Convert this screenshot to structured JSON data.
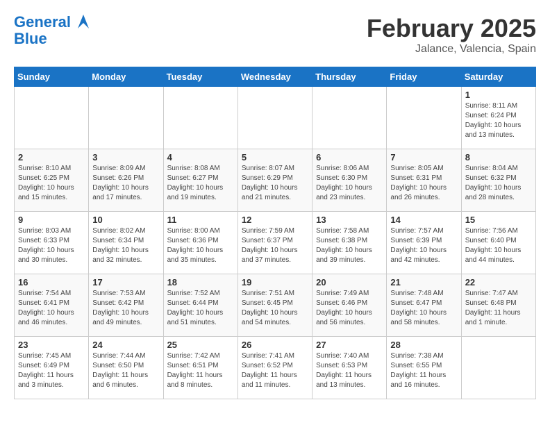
{
  "header": {
    "logo_line1": "General",
    "logo_line2": "Blue",
    "title": "February 2025",
    "subtitle": "Jalance, Valencia, Spain"
  },
  "weekdays": [
    "Sunday",
    "Monday",
    "Tuesday",
    "Wednesday",
    "Thursday",
    "Friday",
    "Saturday"
  ],
  "weeks": [
    [
      {
        "day": "",
        "info": ""
      },
      {
        "day": "",
        "info": ""
      },
      {
        "day": "",
        "info": ""
      },
      {
        "day": "",
        "info": ""
      },
      {
        "day": "",
        "info": ""
      },
      {
        "day": "",
        "info": ""
      },
      {
        "day": "1",
        "info": "Sunrise: 8:11 AM\nSunset: 6:24 PM\nDaylight: 10 hours and 13 minutes."
      }
    ],
    [
      {
        "day": "2",
        "info": "Sunrise: 8:10 AM\nSunset: 6:25 PM\nDaylight: 10 hours and 15 minutes."
      },
      {
        "day": "3",
        "info": "Sunrise: 8:09 AM\nSunset: 6:26 PM\nDaylight: 10 hours and 17 minutes."
      },
      {
        "day": "4",
        "info": "Sunrise: 8:08 AM\nSunset: 6:27 PM\nDaylight: 10 hours and 19 minutes."
      },
      {
        "day": "5",
        "info": "Sunrise: 8:07 AM\nSunset: 6:29 PM\nDaylight: 10 hours and 21 minutes."
      },
      {
        "day": "6",
        "info": "Sunrise: 8:06 AM\nSunset: 6:30 PM\nDaylight: 10 hours and 23 minutes."
      },
      {
        "day": "7",
        "info": "Sunrise: 8:05 AM\nSunset: 6:31 PM\nDaylight: 10 hours and 26 minutes."
      },
      {
        "day": "8",
        "info": "Sunrise: 8:04 AM\nSunset: 6:32 PM\nDaylight: 10 hours and 28 minutes."
      }
    ],
    [
      {
        "day": "9",
        "info": "Sunrise: 8:03 AM\nSunset: 6:33 PM\nDaylight: 10 hours and 30 minutes."
      },
      {
        "day": "10",
        "info": "Sunrise: 8:02 AM\nSunset: 6:34 PM\nDaylight: 10 hours and 32 minutes."
      },
      {
        "day": "11",
        "info": "Sunrise: 8:00 AM\nSunset: 6:36 PM\nDaylight: 10 hours and 35 minutes."
      },
      {
        "day": "12",
        "info": "Sunrise: 7:59 AM\nSunset: 6:37 PM\nDaylight: 10 hours and 37 minutes."
      },
      {
        "day": "13",
        "info": "Sunrise: 7:58 AM\nSunset: 6:38 PM\nDaylight: 10 hours and 39 minutes."
      },
      {
        "day": "14",
        "info": "Sunrise: 7:57 AM\nSunset: 6:39 PM\nDaylight: 10 hours and 42 minutes."
      },
      {
        "day": "15",
        "info": "Sunrise: 7:56 AM\nSunset: 6:40 PM\nDaylight: 10 hours and 44 minutes."
      }
    ],
    [
      {
        "day": "16",
        "info": "Sunrise: 7:54 AM\nSunset: 6:41 PM\nDaylight: 10 hours and 46 minutes."
      },
      {
        "day": "17",
        "info": "Sunrise: 7:53 AM\nSunset: 6:42 PM\nDaylight: 10 hours and 49 minutes."
      },
      {
        "day": "18",
        "info": "Sunrise: 7:52 AM\nSunset: 6:44 PM\nDaylight: 10 hours and 51 minutes."
      },
      {
        "day": "19",
        "info": "Sunrise: 7:51 AM\nSunset: 6:45 PM\nDaylight: 10 hours and 54 minutes."
      },
      {
        "day": "20",
        "info": "Sunrise: 7:49 AM\nSunset: 6:46 PM\nDaylight: 10 hours and 56 minutes."
      },
      {
        "day": "21",
        "info": "Sunrise: 7:48 AM\nSunset: 6:47 PM\nDaylight: 10 hours and 58 minutes."
      },
      {
        "day": "22",
        "info": "Sunrise: 7:47 AM\nSunset: 6:48 PM\nDaylight: 11 hours and 1 minute."
      }
    ],
    [
      {
        "day": "23",
        "info": "Sunrise: 7:45 AM\nSunset: 6:49 PM\nDaylight: 11 hours and 3 minutes."
      },
      {
        "day": "24",
        "info": "Sunrise: 7:44 AM\nSunset: 6:50 PM\nDaylight: 11 hours and 6 minutes."
      },
      {
        "day": "25",
        "info": "Sunrise: 7:42 AM\nSunset: 6:51 PM\nDaylight: 11 hours and 8 minutes."
      },
      {
        "day": "26",
        "info": "Sunrise: 7:41 AM\nSunset: 6:52 PM\nDaylight: 11 hours and 11 minutes."
      },
      {
        "day": "27",
        "info": "Sunrise: 7:40 AM\nSunset: 6:53 PM\nDaylight: 11 hours and 13 minutes."
      },
      {
        "day": "28",
        "info": "Sunrise: 7:38 AM\nSunset: 6:55 PM\nDaylight: 11 hours and 16 minutes."
      },
      {
        "day": "",
        "info": ""
      }
    ]
  ]
}
